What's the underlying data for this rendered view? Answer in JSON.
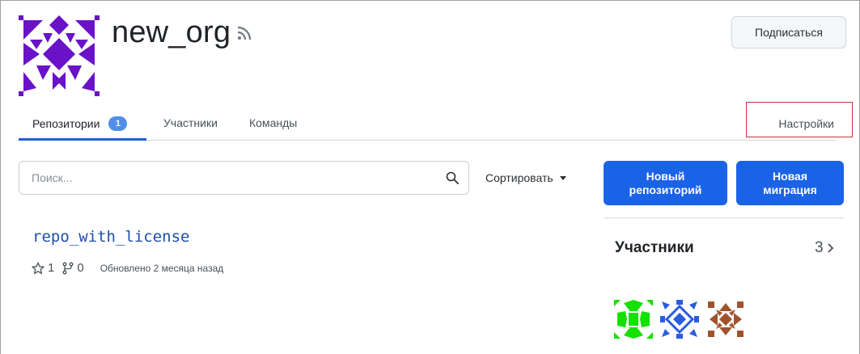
{
  "org": {
    "name": "new_org",
    "avatar_color": "#6a12c8"
  },
  "header": {
    "subscribe_label": "Подписаться"
  },
  "tabs": {
    "repositories_label": "Репозитории",
    "repositories_count": "1",
    "members_label": "Участники",
    "teams_label": "Команды",
    "settings_label": "Настройки"
  },
  "search": {
    "placeholder": "Поиск...",
    "value": ""
  },
  "sort": {
    "label": "Сортировать"
  },
  "actions": {
    "new_repo_line1": "Новый",
    "new_repo_line2": "репозиторий",
    "new_migration_line1": "Новая",
    "new_migration_line2": "миграция",
    "accent": "#1a63e6"
  },
  "repos": [
    {
      "name": "repo_with_license",
      "stars": "1",
      "forks": "0",
      "updated": "Обновлено 2 месяца назад"
    }
  ],
  "sidebar": {
    "members_title": "Участники",
    "members_count": "3",
    "member_avatars": [
      {
        "color": "#15e000"
      },
      {
        "color": "#2a5ce0"
      },
      {
        "color": "#a0522d"
      }
    ]
  }
}
